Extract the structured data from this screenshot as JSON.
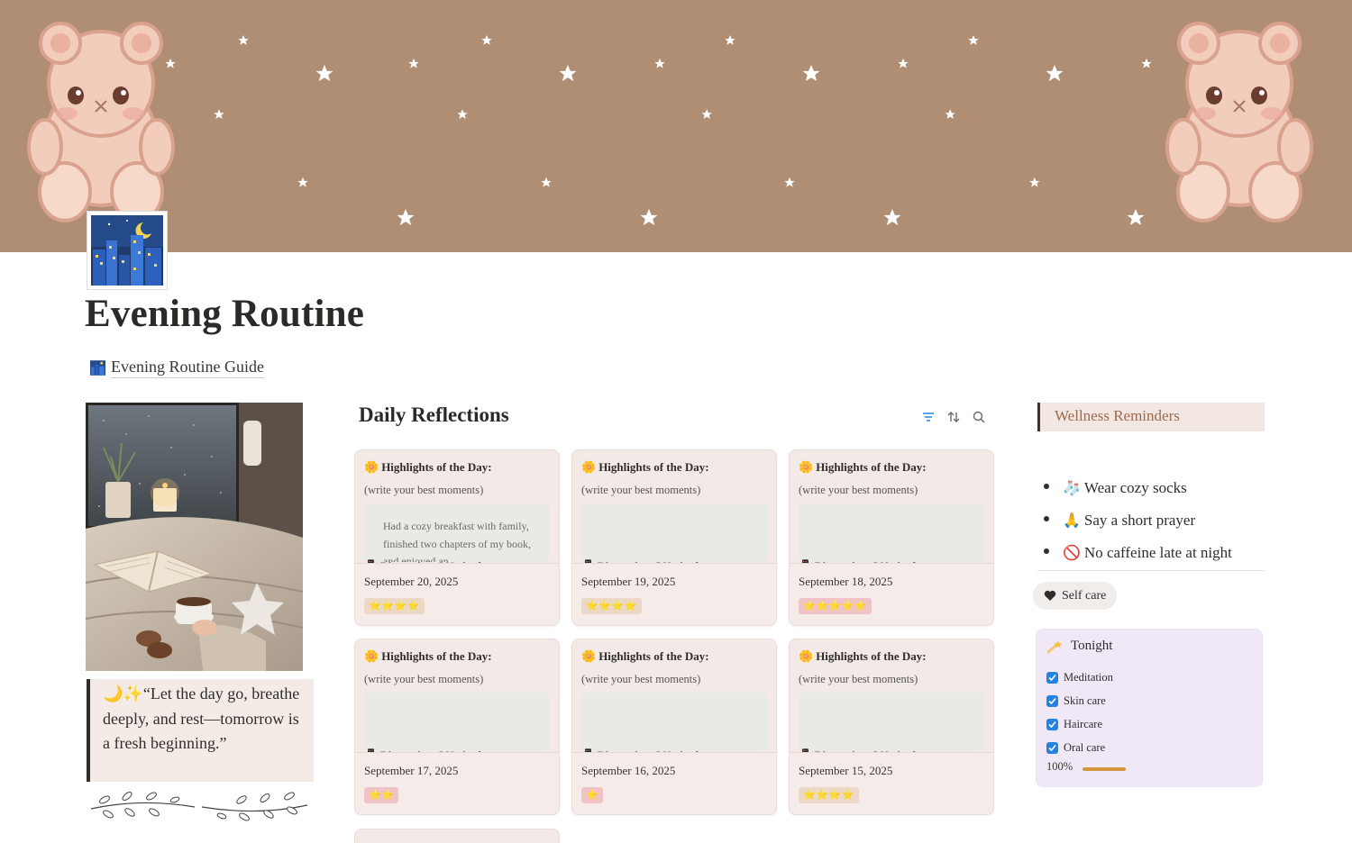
{
  "page": {
    "title": "Evening Routine",
    "icon": "night-city-icon"
  },
  "guide_link": {
    "icon": "night-city-icon",
    "label": "Evening Routine Guide"
  },
  "quote": {
    "emoji": "🌙✨",
    "text": "“Let the day go, breathe deeply, and rest—tomorrow is a fresh beginning.”"
  },
  "board": {
    "title": "Daily Reflections",
    "tools": [
      "filter-icon",
      "sort-icon",
      "search-icon"
    ],
    "highlights_label": "Highlights of the Day:",
    "highlights_prompt": "(write your best moments)",
    "distractions_label": "Distractions I Noticed:",
    "cards": [
      {
        "note": "Had a cozy breakfast with family, finished two chapters of my book, and enjoyed an",
        "date": "September 20, 2025",
        "rating": "⭐⭐⭐⭐",
        "rating_color": "#ecd8c7"
      },
      {
        "note": "",
        "date": "September 19, 2025",
        "rating": "⭐⭐⭐⭐",
        "rating_color": "#ecd8c7"
      },
      {
        "note": "",
        "date": "September 18, 2025",
        "rating": "⭐⭐⭐⭐⭐",
        "rating_color": "#f0c4c6"
      },
      {
        "note": "",
        "date": "September 17, 2025",
        "rating": "⭐⭐",
        "rating_color": "#f0c4c6"
      },
      {
        "note": "",
        "date": "September 16, 2025",
        "rating": "⭐",
        "rating_color": "#f0c4c6"
      },
      {
        "note": "",
        "date": "September 15, 2025",
        "rating": "⭐⭐⭐⭐",
        "rating_color": "#ecd8c7"
      }
    ]
  },
  "wellness": {
    "heading": "Wellness Reminders",
    "items": [
      {
        "emoji": "🧦",
        "text": "Wear cozy socks"
      },
      {
        "emoji": "🙏",
        "text": "Say a short prayer"
      },
      {
        "emoji": "🚫",
        "text": "No caffeine late at night"
      }
    ]
  },
  "selfcare_button": {
    "icon": "black-heart-icon",
    "label": "Self care"
  },
  "tonight": {
    "icon": "shooting-star-icon",
    "title": "Tonight",
    "items": [
      {
        "label": "Meditation",
        "checked": true
      },
      {
        "label": "Skin care",
        "checked": true
      },
      {
        "label": "Haircare",
        "checked": true
      },
      {
        "label": "Oral care",
        "checked": true
      }
    ],
    "progress_label": "100%",
    "progress": 1.0,
    "progress_color": "#d4963e"
  },
  "colors": {
    "cover": "#b08e73",
    "card_bg": "#f3e9e6",
    "accent_blue": "#2383e2",
    "wellness_text": "#9c6a4e"
  }
}
